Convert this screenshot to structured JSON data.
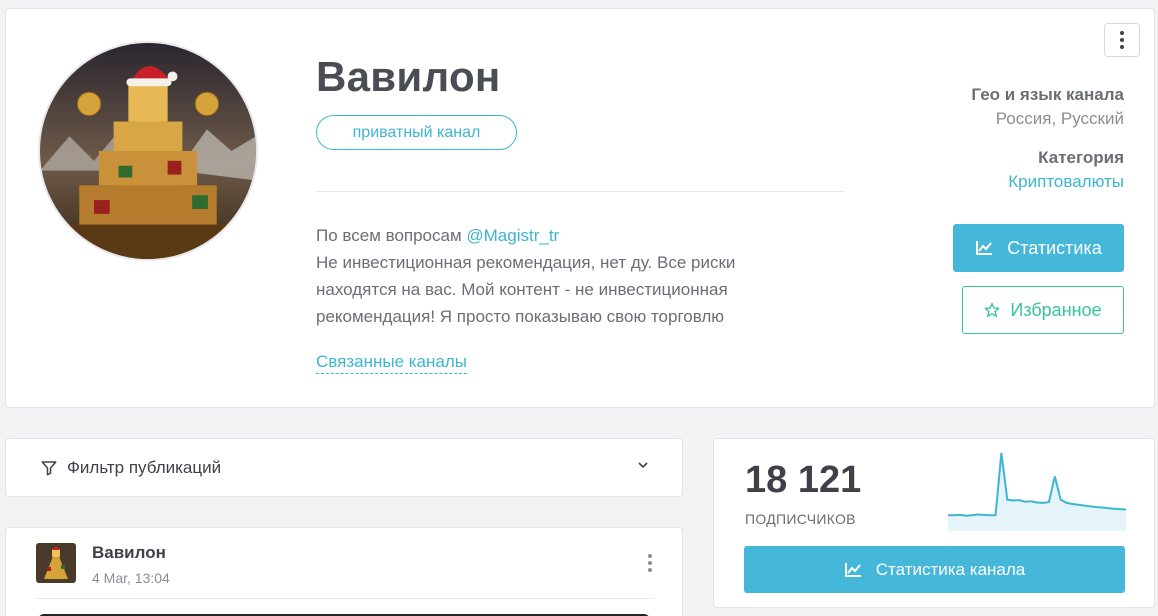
{
  "channel": {
    "title": "Вавилон",
    "badge": "приватный канал",
    "description_prefix": "По всем вопросам ",
    "description_contact": "@Magistr_tr",
    "description_text": "Не инвестиционная рекомендация, нет ду. Все риски находятся на вас. Мой контент - не инвестиционная рекомендация! Я просто показываю свою торговлю",
    "related_link": "Связанные каналы"
  },
  "meta": {
    "geo_label": "Гео и язык канала",
    "geo_value": "Россия, Русский",
    "category_label": "Категория",
    "category_value": "Криптовалюты"
  },
  "actions": {
    "stats_label": "Статистика",
    "favorite_label": "Избранное"
  },
  "filter": {
    "label": "Фильтр публикаций"
  },
  "post": {
    "author": "Вавилон",
    "date": "4 Mar, 13:04"
  },
  "subscribers": {
    "count": "18 121",
    "label": "ПОДПИСЧИКОВ",
    "button_label": "Статистика канала",
    "trend": [
      3,
      3,
      3.1,
      2.9,
      3,
      3.2,
      3.1,
      3,
      3,
      19,
      7,
      6.8,
      6.9,
      6.5,
      6.6,
      6.3,
      6.2,
      6.4,
      13,
      7,
      6.2,
      5.9,
      5.7,
      5.5,
      5.3,
      5.1,
      5,
      4.8,
      4.7,
      4.6,
      4.5
    ],
    "line_color": "#3db6cf",
    "fill_color": "#e4f4f9"
  },
  "colors": {
    "accent": "#45b7d9",
    "favorite": "#39c39a",
    "link": "#3db6cf"
  },
  "icons": {
    "menu": "more-vertical-icon",
    "chart": "line-chart-icon",
    "star": "star-icon",
    "filter": "filter-icon",
    "chevron": "chevron-down-icon"
  }
}
